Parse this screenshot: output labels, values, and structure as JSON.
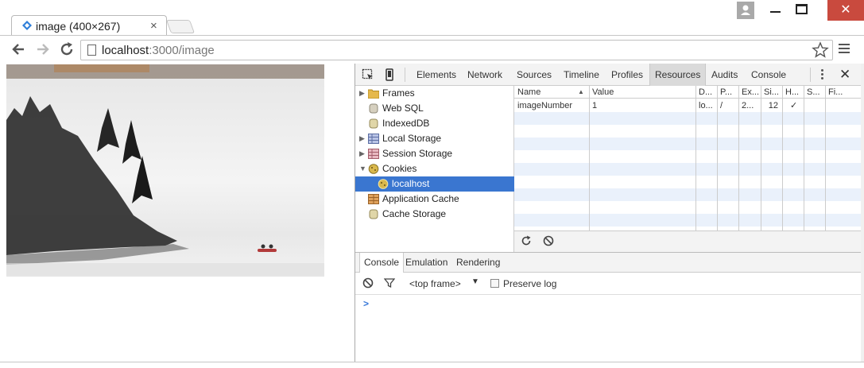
{
  "browser": {
    "tab_title": "image (400×267)",
    "tab_close": "×",
    "url_host": "localhost",
    "url_path": ":3000/image",
    "window_close": "✕"
  },
  "devtools": {
    "tabs": [
      {
        "label": "Elements"
      },
      {
        "label": "Network"
      },
      {
        "label": "Sources"
      },
      {
        "label": "Timeline"
      },
      {
        "label": "Profiles"
      },
      {
        "label": "Resources",
        "active": true
      },
      {
        "label": "Audits"
      },
      {
        "label": "Console"
      }
    ],
    "close": "✕",
    "tree": [
      {
        "label": "Frames",
        "icon": "folder-icon",
        "expand": "closed"
      },
      {
        "label": "Web SQL",
        "icon": "database-icon"
      },
      {
        "label": "IndexedDB",
        "icon": "database-icon"
      },
      {
        "label": "Local Storage",
        "icon": "local-storage-icon",
        "expand": "closed"
      },
      {
        "label": "Session Storage",
        "icon": "session-storage-icon",
        "expand": "closed"
      },
      {
        "label": "Cookies",
        "icon": "cookie-icon",
        "expand": "open"
      },
      {
        "label": "localhost",
        "icon": "cookie-icon",
        "selected": true
      },
      {
        "label": "Application Cache",
        "icon": "app-cache-icon"
      },
      {
        "label": "Cache Storage",
        "icon": "database-icon"
      }
    ],
    "cookie_table": {
      "columns": [
        "Name",
        "Value",
        "D...",
        "P...",
        "Ex...",
        "Si...",
        "H...",
        "S...",
        "Fi..."
      ],
      "rows": [
        [
          "imageNumber",
          "1",
          "lo...",
          "/",
          "2...",
          "12",
          "✓",
          "",
          ""
        ]
      ]
    },
    "drawer_tabs": [
      {
        "label": "Console",
        "active": true
      },
      {
        "label": "Emulation"
      },
      {
        "label": "Rendering"
      }
    ],
    "console": {
      "frame_selector": "<top frame>",
      "preserve_log_label": "Preserve log",
      "preserve_log_checked": false,
      "prompt": ">"
    }
  },
  "colors": {
    "selection": "#3a76d0",
    "alt_row": "#eaf1fb",
    "window_close": "#c94a3e"
  }
}
